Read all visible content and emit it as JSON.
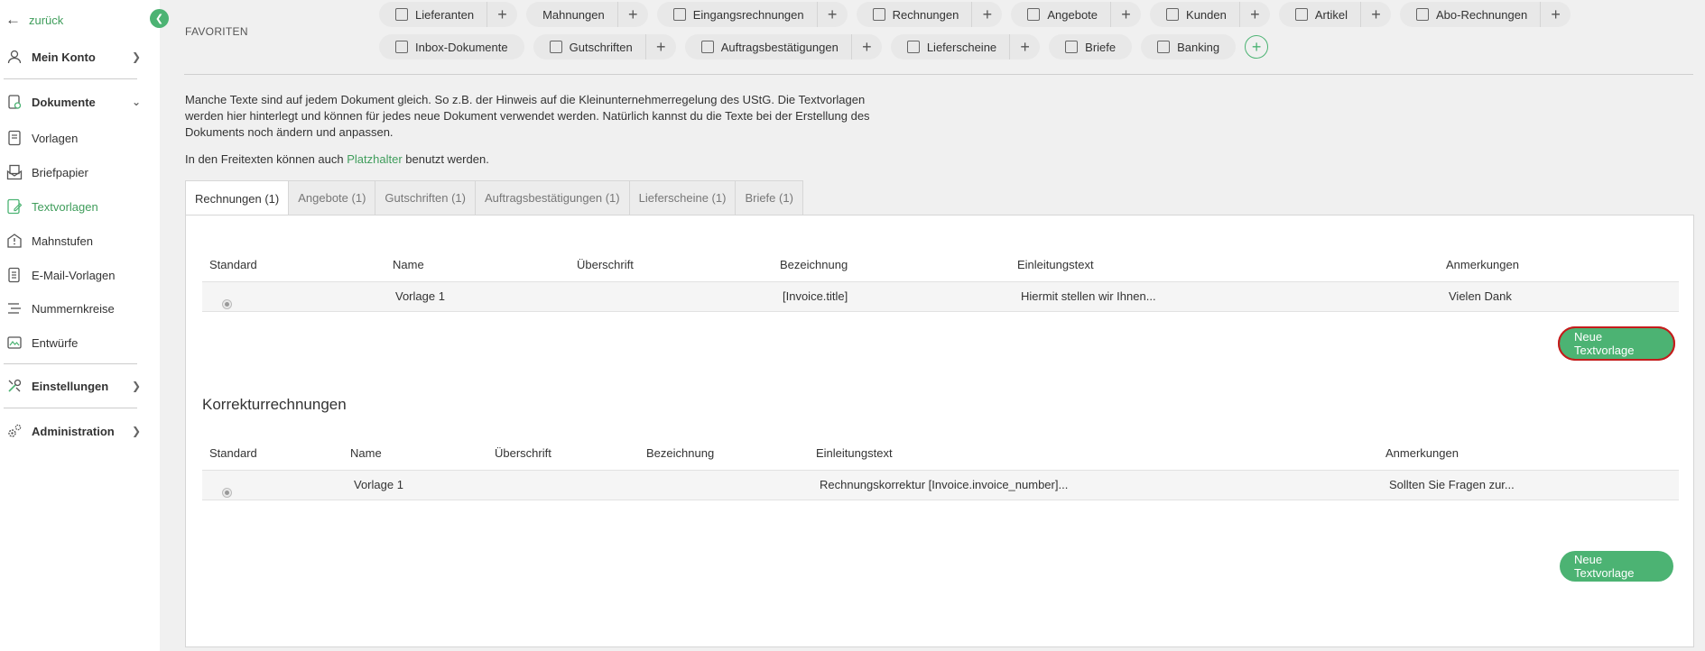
{
  "sidebar": {
    "back_label": "zurück",
    "items": [
      {
        "label": "Mein Konto"
      },
      {
        "label": "Dokumente"
      },
      {
        "label": "Vorlagen"
      },
      {
        "label": "Briefpapier"
      },
      {
        "label": "Textvorlagen"
      },
      {
        "label": "Mahnstufen"
      },
      {
        "label": "E-Mail-Vorlagen"
      },
      {
        "label": "Nummernkreise"
      },
      {
        "label": "Entwürfe"
      },
      {
        "label": "Einstellungen"
      },
      {
        "label": "Administration"
      }
    ]
  },
  "favorites": {
    "label": "FAVORITEN",
    "row1": [
      "Lieferanten",
      "Mahnungen",
      "Eingangsrechnungen",
      "Rechnungen",
      "Angebote",
      "Kunden",
      "Artikel",
      "Abo-Rechnungen"
    ],
    "row2": [
      "Inbox-Dokumente",
      "Gutschriften",
      "Auftragsbestätigungen",
      "Lieferscheine",
      "Briefe",
      "Banking"
    ]
  },
  "intro": {
    "text": "Manche Texte sind auf jedem Dokument gleich. So z.B. der Hinweis auf die Kleinunternehmerregelung des UStG. Die Textvorlagen werden hier hinterlegt und können für jedes neue Dokument verwendet werden. Natürlich kannst du die Texte bei der Erstellung des Dokuments noch ändern und anpassen.",
    "line2_prefix": "In den Freitexten können auch",
    "line2_link": "Platzhalter",
    "line2_suffix": "benutzt werden."
  },
  "tabs": [
    "Rechnungen (1)",
    "Angebote (1)",
    "Gutschriften (1)",
    "Auftragsbestätigungen (1)",
    "Lieferscheine (1)",
    "Briefe (1)"
  ],
  "table1": {
    "headers": {
      "standard": "Standard",
      "name": "Name",
      "ueberschrift": "Überschrift",
      "bezeichnung": "Bezeichnung",
      "einleitung": "Einleitungstext",
      "anmerkungen": "Anmerkungen"
    },
    "row": {
      "name": "Vorlage 1",
      "ueberschrift": "",
      "bezeichnung": "[Invoice.title]",
      "einleitung": "Hiermit stellen wir Ihnen...",
      "anmerkungen": "Vielen Dank"
    },
    "button": "Neue Textvorlage"
  },
  "section2": {
    "title": "Korrekturrechnungen",
    "headers": {
      "standard": "Standard",
      "name": "Name",
      "ueberschrift": "Überschrift",
      "bezeichnung": "Bezeichnung",
      "einleitung": "Einleitungstext",
      "anmerkungen": "Anmerkungen"
    },
    "row": {
      "name": "Vorlage 1",
      "ueberschrift": "",
      "bezeichnung": "",
      "einleitung": "Rechnungskorrektur [Invoice.invoice_number]...",
      "anmerkungen": "Sollten Sie Fragen zur..."
    },
    "button": "Neue Textvorlage"
  },
  "colors": {
    "accent": "#4cb373",
    "link": "#3f9d5b",
    "highlight": "#c41c1c"
  }
}
